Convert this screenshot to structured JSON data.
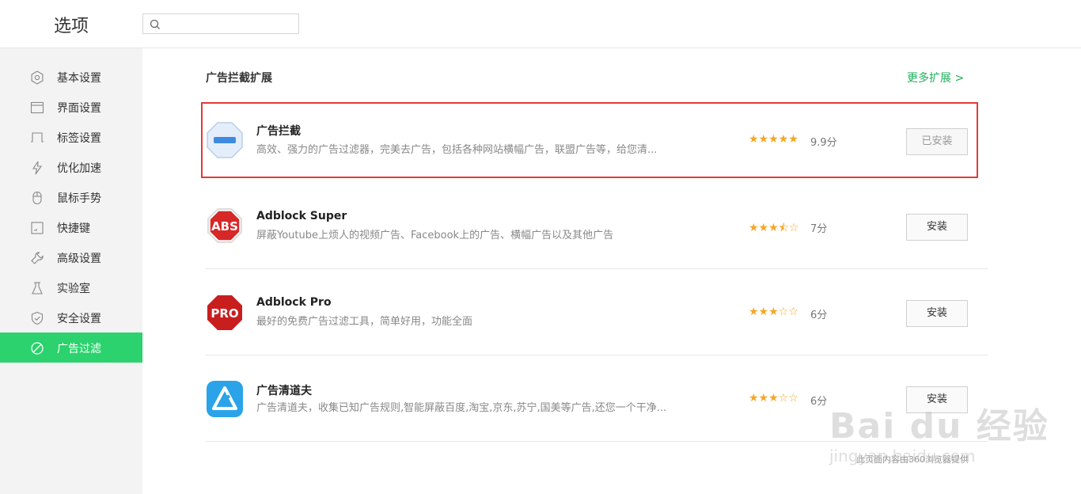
{
  "header": {
    "title": "选项",
    "search": {
      "placeholder": "",
      "value": ""
    }
  },
  "sidebar": {
    "items": [
      {
        "label": "基本设置",
        "icon": "gear-icon"
      },
      {
        "label": "界面设置",
        "icon": "window-icon"
      },
      {
        "label": "标签设置",
        "icon": "tab-icon"
      },
      {
        "label": "优化加速",
        "icon": "lightning-icon"
      },
      {
        "label": "鼠标手势",
        "icon": "mouse-icon"
      },
      {
        "label": "快捷键",
        "icon": "keyboard-icon"
      },
      {
        "label": "高级设置",
        "icon": "wrench-icon"
      },
      {
        "label": "实验室",
        "icon": "flask-icon"
      },
      {
        "label": "安全设置",
        "icon": "shield-icon"
      },
      {
        "label": "广告过滤",
        "icon": "block-icon",
        "active": true
      }
    ]
  },
  "main": {
    "section_title": "广告拦截扩展",
    "more_link": "更多扩展 >",
    "extensions": [
      {
        "name": "广告拦截",
        "desc": "高效、强力的广告过滤器，完美去广告，包括各种网站横幅广告，联盟广告等，给您清...",
        "stars": "★★★★★",
        "rating": 5,
        "score": "9.9分",
        "button": "已安装",
        "installed": true
      },
      {
        "name": "Adblock Super",
        "desc": "屏蔽Youtube上烦人的视频广告、Facebook上的广告、横幅广告以及其他广告",
        "stars": "★★★⯪☆",
        "rating": 3.5,
        "score": "7分",
        "button": "安装",
        "installed": false,
        "icon_text": "ABS"
      },
      {
        "name": "Adblock Pro",
        "desc": "最好的免费广告过滤工具，简单好用，功能全面",
        "stars": "★★★☆☆",
        "rating": 3,
        "score": "6分",
        "button": "安装",
        "installed": false,
        "icon_text": "PRO"
      },
      {
        "name": "广告清道夫",
        "desc": "广告清道夫，收集已知广告规则,智能屏蔽百度,淘宝,京东,苏宁,国美等广告,还您一个干净...",
        "stars": "★★★☆☆",
        "rating": 3,
        "score": "6分",
        "button": "安装",
        "installed": false
      }
    ]
  },
  "watermark": {
    "brand": "Bai du 经验",
    "site": "jingyan.baidu.com",
    "note": "此页面内容由360浏览器提供"
  },
  "colors": {
    "accent": "#2bd26d",
    "link": "#1fae5b",
    "star": "#f5a623",
    "highlight": "#e53935"
  }
}
